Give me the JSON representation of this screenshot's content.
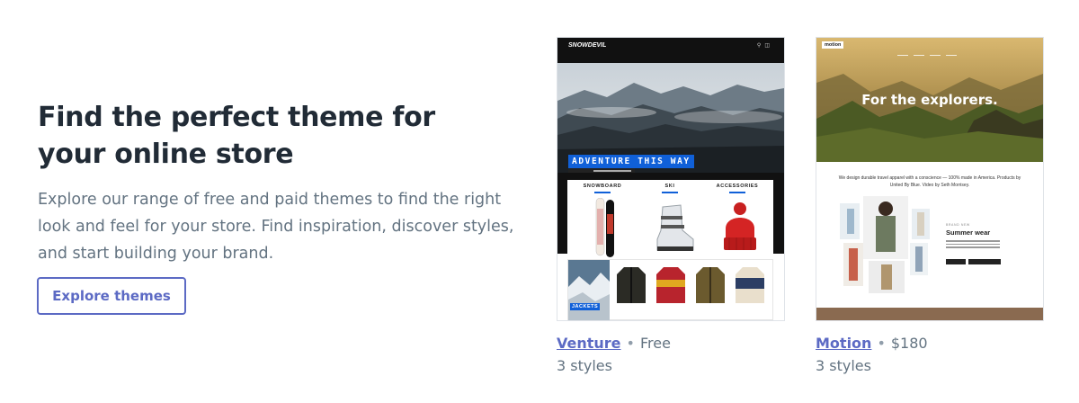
{
  "hero": {
    "title": "Find the perfect theme for your online store",
    "description": "Explore our range of free and paid themes to find the right look and feel for your store. Find inspiration, discover styles, and start building your brand.",
    "cta_label": "Explore themes"
  },
  "themes": [
    {
      "name": "Venture",
      "price": "Free",
      "styles": "3 styles",
      "preview": {
        "logo": "SNOWDEVIL",
        "hero_text": "ADVENTURE THIS WAY",
        "categories": [
          "SNOWBOARD",
          "SKI",
          "ACCESSORIES"
        ],
        "featured_label": "JACKETS"
      }
    },
    {
      "name": "Motion",
      "price": "$180",
      "styles": "3 styles",
      "preview": {
        "logo": "motion",
        "hero_text": "For the explorers.",
        "tagline": "We design durable travel apparel with a conscience — 100% made in America. Products by United By Blue. Video by Seth Morrisey.",
        "section_kicker": "BRAND NEW",
        "section_title": "Summer wear"
      }
    }
  ],
  "colors": {
    "accent": "#5c6ac4",
    "text": "#212b36",
    "muted": "#637381",
    "venture_blue": "#1060d8"
  }
}
